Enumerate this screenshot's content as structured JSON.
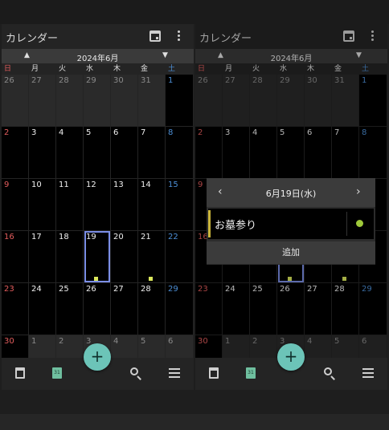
{
  "app": {
    "title": "カレンダー"
  },
  "month": {
    "label": "2024年6月",
    "prev": "▲",
    "next": "▼"
  },
  "weekdays": [
    "日",
    "月",
    "火",
    "水",
    "木",
    "金",
    "土"
  ],
  "weeks": [
    [
      {
        "d": "26",
        "other": true
      },
      {
        "d": "27",
        "other": true
      },
      {
        "d": "28",
        "other": true
      },
      {
        "d": "29",
        "other": true
      },
      {
        "d": "30",
        "other": true
      },
      {
        "d": "31",
        "other": true
      },
      {
        "d": "1"
      }
    ],
    [
      {
        "d": "2"
      },
      {
        "d": "3"
      },
      {
        "d": "4"
      },
      {
        "d": "5"
      },
      {
        "d": "6"
      },
      {
        "d": "7"
      },
      {
        "d": "8"
      }
    ],
    [
      {
        "d": "9"
      },
      {
        "d": "10"
      },
      {
        "d": "11"
      },
      {
        "d": "12"
      },
      {
        "d": "13"
      },
      {
        "d": "14"
      },
      {
        "d": "15"
      }
    ],
    [
      {
        "d": "16"
      },
      {
        "d": "17"
      },
      {
        "d": "18"
      },
      {
        "d": "19",
        "selected": true,
        "event": true
      },
      {
        "d": "20"
      },
      {
        "d": "21",
        "event": true
      },
      {
        "d": "22"
      }
    ],
    [
      {
        "d": "23"
      },
      {
        "d": "24"
      },
      {
        "d": "25"
      },
      {
        "d": "26"
      },
      {
        "d": "27"
      },
      {
        "d": "28"
      },
      {
        "d": "29"
      }
    ],
    [
      {
        "d": "30"
      },
      {
        "d": "1",
        "other": true
      },
      {
        "d": "2",
        "other": true
      },
      {
        "d": "3",
        "other": true
      },
      {
        "d": "4",
        "other": true
      },
      {
        "d": "5",
        "other": true
      },
      {
        "d": "6",
        "other": true
      }
    ]
  ],
  "colors": {
    "sunday": "#e35d5d",
    "saturday": "#4d8fd6",
    "selection": "#7b8ee6",
    "event_marker": "#dbe85c",
    "fab": "#6cc4b8"
  },
  "fab": {
    "label": "+"
  },
  "nav": {
    "day_icon_text": "31",
    "icons": [
      "calendar-month-icon",
      "calendar-day-icon",
      "search-icon",
      "menu-icon"
    ]
  },
  "popup": {
    "date": "6月19日(水)",
    "prev": "‹",
    "next": "›",
    "event_title": "お墓参り",
    "event_color": "#c9b43a",
    "status_color": "#9fc93a",
    "add_label": "追加"
  }
}
